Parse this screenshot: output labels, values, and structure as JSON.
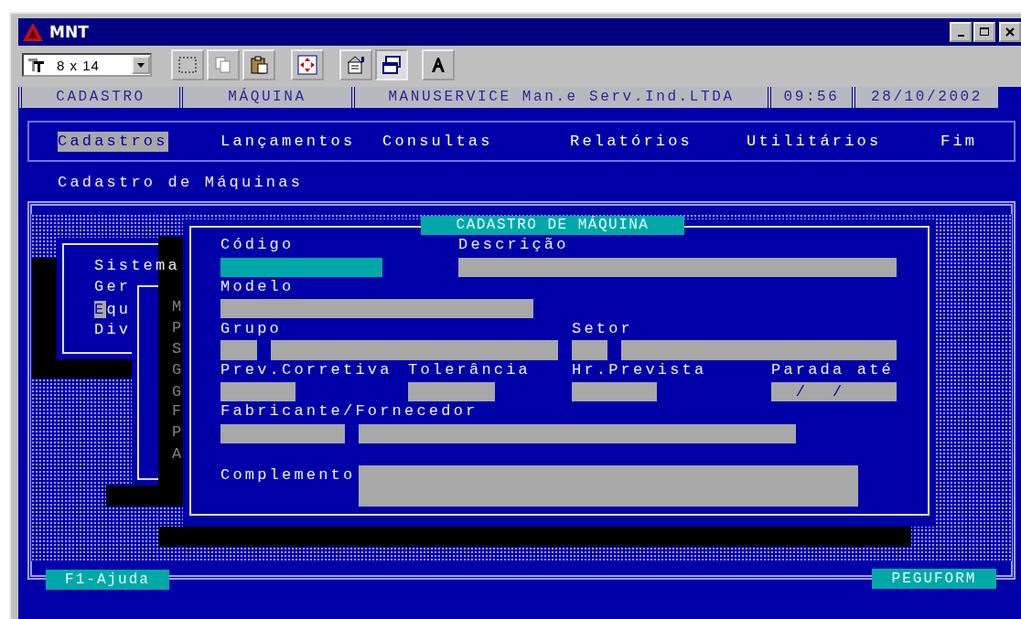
{
  "window": {
    "title": "MNT"
  },
  "toolbar": {
    "font_size": "8 x 14"
  },
  "status_line": [
    "CADASTRO",
    "MÁQUINA",
    "MANUSERVICE Man.e Serv.Ind.LTDA",
    "09:56",
    "28/10/2002"
  ],
  "menu": [
    {
      "label": "Cadastros",
      "selected": true
    },
    {
      "label": "Lançamentos",
      "selected": false
    },
    {
      "label": "Consultas",
      "selected": false
    },
    {
      "label": "Relatórios",
      "selected": false
    },
    {
      "label": "Utilitários",
      "selected": false
    },
    {
      "label": "Fim",
      "selected": false
    }
  ],
  "screen_title": "Cadastro de Máquinas",
  "background_menu": [
    {
      "label": "Sistema",
      "selected": false
    },
    {
      "label": "Ger",
      "selected": false
    },
    {
      "label": "Equ",
      "selected": true
    },
    {
      "label": "Div",
      "selected": false
    }
  ],
  "background_submenu": [
    "M",
    "P",
    "S",
    "G",
    "G",
    "F",
    "P",
    "A"
  ],
  "dialog": {
    "title": "CADASTRO DE MÁQUINA",
    "fields": [
      {
        "label": "Código",
        "inputs": [
          {
            "focused": true
          }
        ]
      },
      {
        "label": "Descrição",
        "inputs": [
          {
            "focused": false
          }
        ]
      },
      {
        "label": "Modelo",
        "inputs": [
          {
            "focused": false
          }
        ]
      },
      {
        "label": "Grupo",
        "inputs": [
          {
            "focused": false
          },
          {
            "focused": false
          }
        ]
      },
      {
        "label": "Setor",
        "inputs": [
          {
            "focused": false
          },
          {
            "focused": false
          }
        ]
      },
      {
        "label": "Prev.Corretiva",
        "inputs": [
          {
            "focused": false
          }
        ]
      },
      {
        "label": "Tolerância",
        "inputs": [
          {
            "focused": false
          }
        ]
      },
      {
        "label": "Hr.Prevista",
        "inputs": [
          {
            "focused": false
          }
        ]
      },
      {
        "label": "Parada até",
        "inputs": [
          {
            "focused": false,
            "value": "  /  /"
          }
        ]
      },
      {
        "label": "Fabricante/Fornecedor",
        "inputs": [
          {
            "focused": false
          },
          {
            "focused": false
          }
        ]
      },
      {
        "label": "Complemento",
        "inputs": [
          {
            "focused": false
          }
        ]
      }
    ]
  },
  "footer": {
    "help": "F1-Ajuda",
    "form": "PEGUFORM"
  }
}
